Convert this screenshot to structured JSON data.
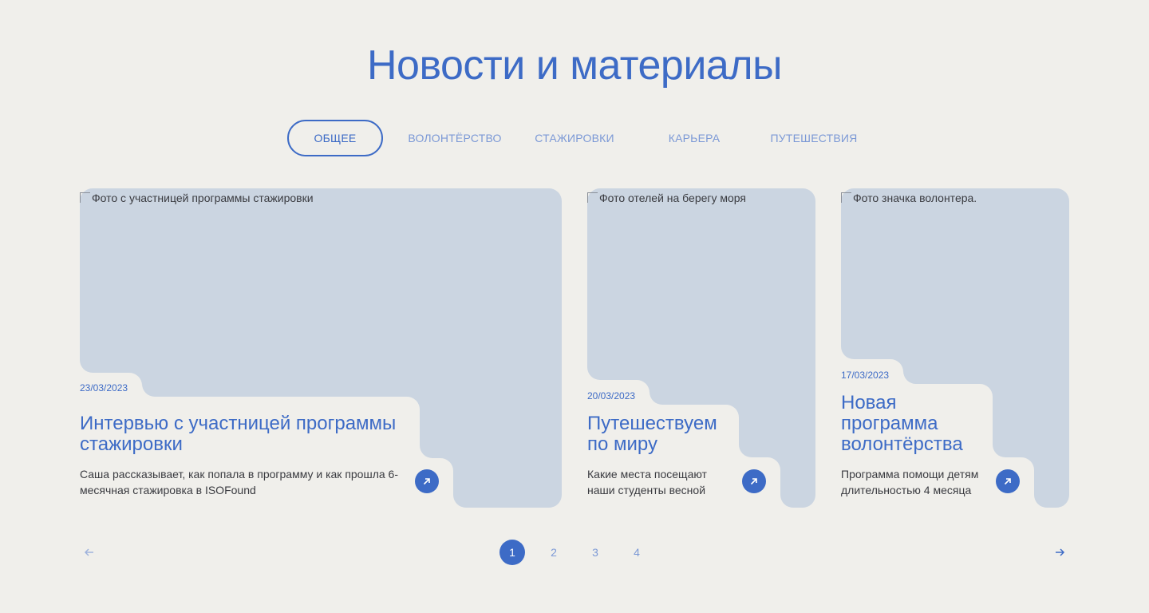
{
  "section": {
    "title": "Новости и материалы"
  },
  "tabs": [
    {
      "label": "ОБЩЕЕ",
      "active": true
    },
    {
      "label": "ВОЛОНТЁРСТВО",
      "active": false
    },
    {
      "label": "СТАЖИРОВКИ",
      "active": false
    },
    {
      "label": "КАРЬЕРА",
      "active": false
    },
    {
      "label": "ПУТЕШЕСТВИЯ",
      "active": false
    }
  ],
  "cards": [
    {
      "image_alt": "Фото с участницей программы стажировки",
      "date": "23/03/2023",
      "title_lines": [
        "Интервью с участницей программы",
        "стажировки"
      ],
      "desc_lines": [
        "Саша рассказывает, как попала в программу и как прошла 6-",
        "месячная стажировка в ISOFound"
      ]
    },
    {
      "image_alt": "Фото отелей на берегу моря",
      "date": "20/03/2023",
      "title_lines": [
        "Путешествуем",
        "по миру"
      ],
      "desc_lines": [
        "Какие места посещают",
        "наши студенты весной"
      ]
    },
    {
      "image_alt": "Фото значка волонтера.",
      "date": "17/03/2023",
      "title_lines": [
        "Новая",
        "программа",
        "волонтёрства"
      ],
      "desc_lines": [
        "Программа помощи детям",
        "длительностью 4 месяца"
      ]
    }
  ],
  "pagination": {
    "pages": [
      "1",
      "2",
      "3",
      "4"
    ],
    "current": "1"
  },
  "colors": {
    "background": "#f0efeb",
    "accent": "#3d6bc6",
    "accent_light": "#7c99d6",
    "image_placeholder": "#cbd5e1"
  }
}
